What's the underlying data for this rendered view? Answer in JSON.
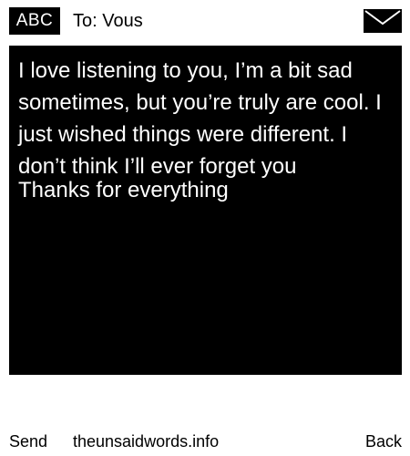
{
  "header": {
    "mode_label": "ABC",
    "recipient": "To: Vous",
    "mail_icon": "envelope-icon"
  },
  "message": {
    "body": "I love listening to you, I’m a bit sad sometimes, but you’re truly are cool. I just wished things were different. I don’t think I’ll ever forget you",
    "signoff": "Thanks for everything"
  },
  "footer": {
    "send_label": "Send",
    "site": "theunsaidwords.info",
    "back_label": "Back"
  },
  "colors": {
    "background": "#ffffff",
    "message_box": "#000000",
    "message_text": "#ffffff"
  }
}
